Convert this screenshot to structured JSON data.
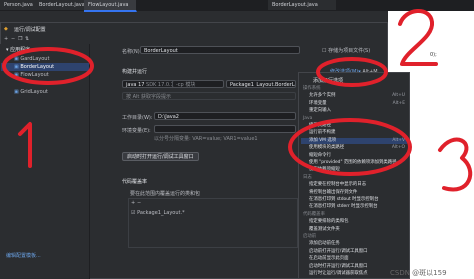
{
  "editor_tabs": [
    "Person.java",
    "BorderLayout.java",
    "FlowLayout.java"
  ],
  "editor_code_fragment": "0);",
  "dialog": {
    "title": "运行/调试配置",
    "sidebar_header": "应用程序",
    "sidebar_items": [
      "GardLayout",
      "BorderLayout",
      "FlowLayout",
      "GridLayout"
    ],
    "sidebar_footer": "编辑配置模板..."
  },
  "form": {
    "name_label": "名称(N):",
    "name_value": "BorderLayout",
    "store_label": "存储为项目文件(S)",
    "build_run_label": "构建并运行",
    "modify_options": "修改选项(M)",
    "modify_shortcut": "Alt+M",
    "jdk_value": "java 17",
    "jdk_hint": "SDK 17.0.12",
    "classpath_hint": "-cp 模块",
    "main_class": "Package1_Layout.BorderLayout",
    "vm_hint": "按 Alt 获取字段提示",
    "workdir_label": "工作目录(W):",
    "workdir_value": "D:\\Java2",
    "env_label": "环境变量(E):",
    "env_hint": "以分号分隔变量: VAR=value; VAR1=value1",
    "open_tool_button": "启动时打开运行/调试工具窗口",
    "code_coverage_label": "代码覆盖率",
    "include_label": "要在此范围内覆盖运行的类和包",
    "coverage_item": "Package1_Layout.*"
  },
  "menu": {
    "title": "添加运行选项",
    "items": [
      {
        "text": "操作系统",
        "shortcut": "",
        "header": true,
        "selected": false
      },
      {
        "text": "允许多个实例",
        "shortcut": "Alt+U",
        "header": false,
        "selected": false
      },
      {
        "text": "环境变量",
        "shortcut": "Alt+E",
        "header": false,
        "selected": false
      },
      {
        "text": "重定向输入",
        "shortcut": "",
        "header": false,
        "selected": false
      },
      {
        "text": "Java",
        "shortcut": "",
        "header": true,
        "selected": false
      },
      {
        "text": "修改类路径",
        "shortcut": "",
        "header": false,
        "selected": false
      },
      {
        "text": "运行前不构建",
        "shortcut": "",
        "header": false,
        "selected": false
      },
      {
        "text": "添加 VM 选项",
        "shortcut": "Alt+V",
        "header": false,
        "selected": true
      },
      {
        "text": "使用模块的类路径",
        "shortcut": "Alt+O",
        "header": false,
        "selected": false
      },
      {
        "text": "缩短命令行",
        "shortcut": "",
        "header": false,
        "selected": false
      },
      {
        "text": "使用 \"provided\" 范围的依赖项添加到类路径",
        "shortcut": "",
        "header": false,
        "selected": false
      },
      {
        "text": "使用依赖项缩短",
        "shortcut": "",
        "header": false,
        "selected": false
      },
      {
        "text": "日志",
        "shortcut": "",
        "header": true,
        "selected": false
      },
      {
        "text": "指定要在控制台中显示的日志",
        "shortcut": "",
        "header": false,
        "selected": false
      },
      {
        "text": "将控制台输出保存到文件",
        "shortcut": "",
        "header": false,
        "selected": false
      },
      {
        "text": "在消息打印到 stdout 时显示控制台",
        "shortcut": "",
        "header": false,
        "selected": false
      },
      {
        "text": "在消息打印到 stderr 时显示控制台",
        "shortcut": "",
        "header": false,
        "selected": false
      },
      {
        "text": "代码覆盖率",
        "shortcut": "",
        "header": true,
        "selected": false
      },
      {
        "text": "指定要排除的类和包",
        "shortcut": "",
        "header": false,
        "selected": false
      },
      {
        "text": "覆盖测试文件夹",
        "shortcut": "",
        "header": false,
        "selected": false
      },
      {
        "text": "启动前",
        "shortcut": "",
        "header": true,
        "selected": false
      },
      {
        "text": "添加启动前任务",
        "shortcut": "",
        "header": false,
        "selected": false
      },
      {
        "text": "启动前打开运行/调试工具窗口",
        "shortcut": "",
        "header": false,
        "selected": false
      },
      {
        "text": "在启动前显示此页面",
        "shortcut": "",
        "header": false,
        "selected": false
      },
      {
        "text": "启动时打开运行/调试工具窗口",
        "shortcut": "",
        "header": false,
        "selected": false
      },
      {
        "text": "运行时让运行/调试器获取焦点",
        "shortcut": "",
        "header": false,
        "selected": false
      }
    ]
  },
  "annotations": {
    "labels": [
      "1",
      "2",
      "3"
    ]
  },
  "watermark": "CSDN @斑以159",
  "colors": {
    "bg": "#2b2d30",
    "accent": "#3574f0",
    "red": "#e0212b",
    "selection": "#2e436e"
  }
}
